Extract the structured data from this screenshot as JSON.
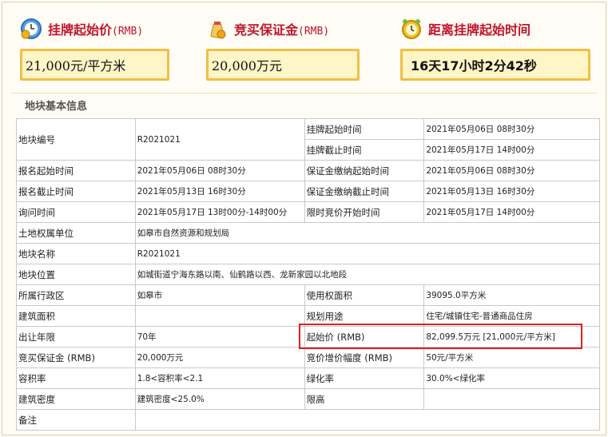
{
  "top": {
    "start_price": {
      "label": "挂牌起始价",
      "unit": "(RMB)",
      "value": "21,000元/平方米",
      "icon": "clock-dollar-icon"
    },
    "deposit": {
      "label": "竞买保证金",
      "unit": "(RMB)",
      "value": "20,000万元",
      "icon": "money-bag-icon"
    },
    "countdown": {
      "label": "距离挂牌起始时间",
      "value": "16天17小时2分42秒",
      "icon": "alarm-clock-icon"
    }
  },
  "section_title": "地块基本信息",
  "rows": {
    "r1": {
      "k1": "地块编号",
      "v1": "R2021021",
      "k2a": "挂牌起始时间",
      "v2a": "2021年05月06日 08时30分",
      "k2b": "挂牌截止时间",
      "v2b": "2021年05月17日 14时00分"
    },
    "r2": {
      "k1": "报名起始时间",
      "v1": "2021年05月06日 08时30分",
      "k2": "保证金缴纳起始时间",
      "v2": "2021年05月06日 08时30分"
    },
    "r3": {
      "k1": "报名截止时间",
      "v1": "2021年05月13日 16时30分",
      "k2": "保证金缴纳截止时间",
      "v2": "2021年05月13日 16时30分"
    },
    "r4": {
      "k1": "询问时间",
      "v1": "2021年05月17日 13时00分-14时00分",
      "k2": "限时竞价开始时间",
      "v2": "2021年05月17日 14时00分"
    },
    "r5": {
      "k1": "土地权属单位",
      "v1": "如皋市自然资源和规划局"
    },
    "r6": {
      "k1": "地块名称",
      "v1": "R2021021"
    },
    "r7": {
      "k1": "地块位置",
      "v1": "如城街道宁海东路以南、仙鹤路以西、龙新家园以北地段"
    },
    "r8": {
      "k1": "所属行政区",
      "v1": "如皋市",
      "k2": "使用权面积",
      "v2": "39095.0平方米"
    },
    "r9": {
      "k1": "建筑面积",
      "v1": "",
      "k2": "规划用途",
      "v2": "住宅/城镇住宅-普通商品住房"
    },
    "r10": {
      "k1": "出让年限",
      "v1": "70年",
      "k2": "起始价 (RMB)",
      "v2": "82,099.5万元 [21,000元/平方米]"
    },
    "r11": {
      "k1": "竞买保证金 (RMB)",
      "v1": "20,000万元",
      "k2": "竞价增价幅度 (RMB)",
      "v2": "50元/平方米"
    },
    "r12": {
      "k1": "容积率",
      "v1": "1.8<容积率<2.1",
      "k2": "绿化率",
      "v2": "30.0%<绿化率"
    },
    "r13": {
      "k1": "建筑密度",
      "v1": "建筑密度<25.0%",
      "k2": "限高",
      "v2": ""
    },
    "r14": {
      "k1": "备注",
      "v1": ""
    }
  },
  "colors": {
    "accent": "#c0142a",
    "box_border": "#f0bf44",
    "box_bg": "#fff5c6",
    "highlight": "#e02020"
  }
}
